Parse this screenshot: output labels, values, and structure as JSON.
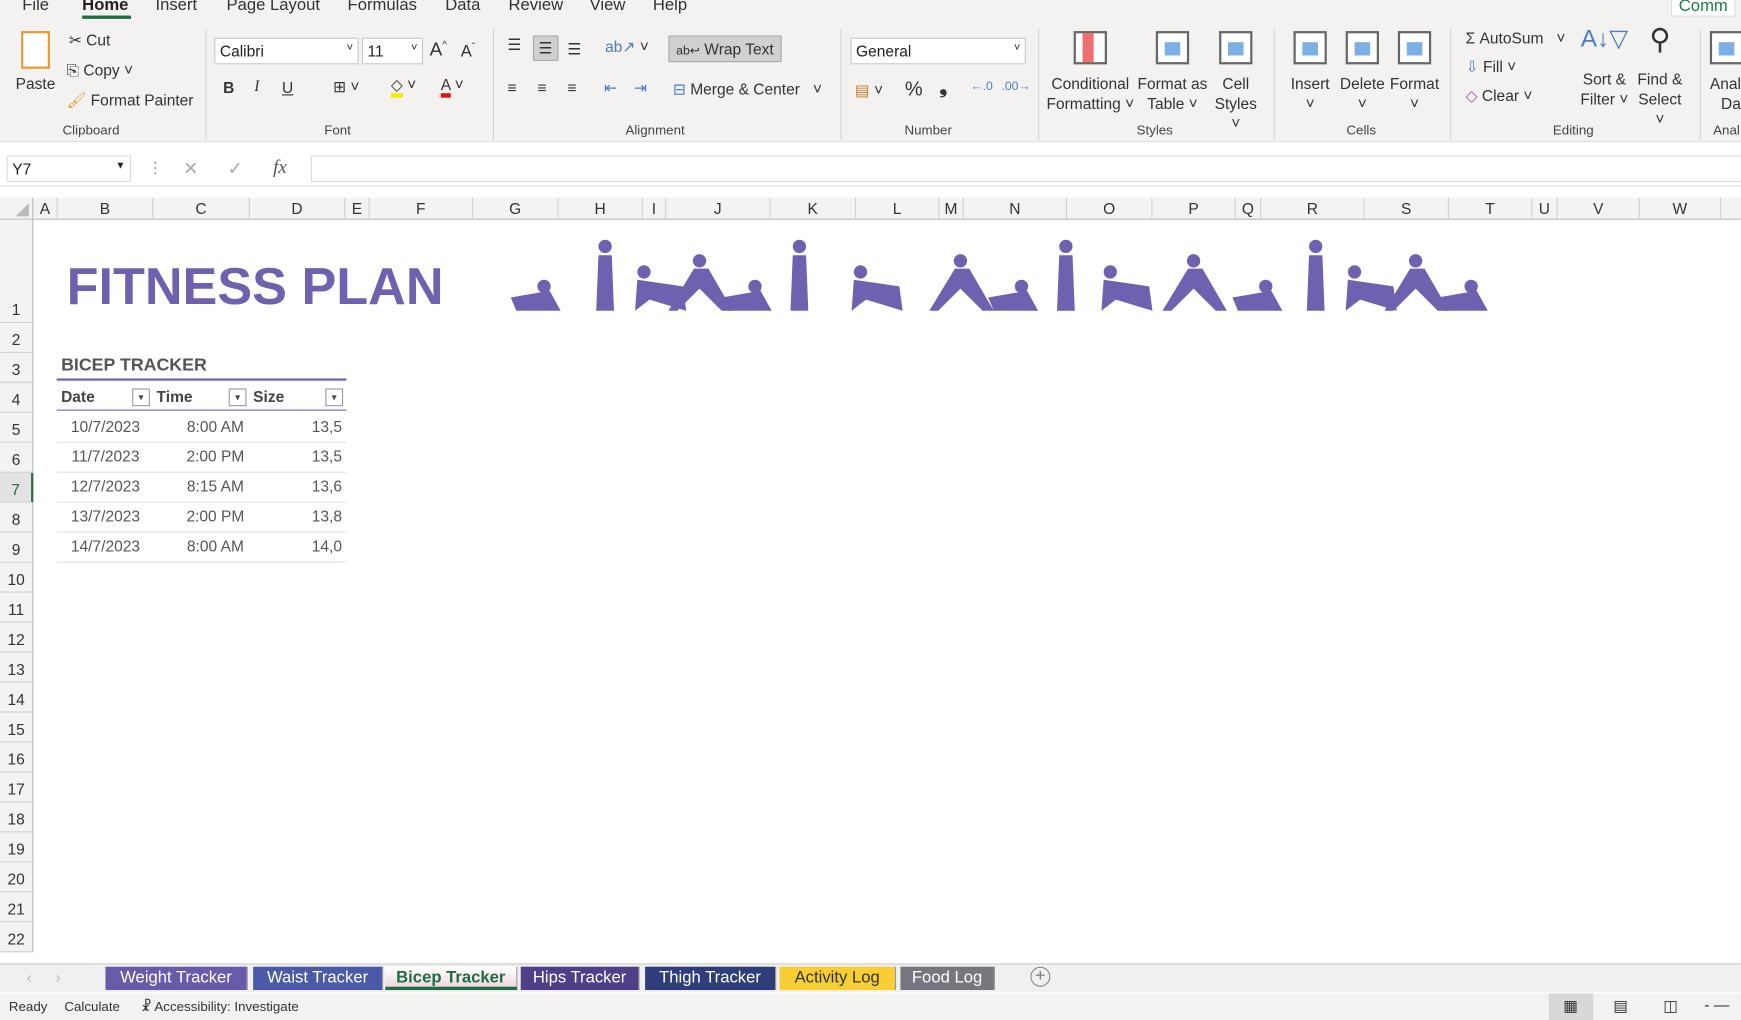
{
  "menu": [
    "File",
    "Home",
    "Insert",
    "Page Layout",
    "Formulas",
    "Data",
    "Review",
    "View",
    "Help"
  ],
  "comments_label": "Comm",
  "clipboard": {
    "paste": "Paste",
    "cut": "Cut",
    "copy": "Copy",
    "format_painter": "Format Painter",
    "group": "Clipboard"
  },
  "font": {
    "name": "Calibri",
    "size": "11",
    "bold": "B",
    "italic": "I",
    "underline": "U",
    "group": "Font"
  },
  "alignment": {
    "wrap_text": "Wrap Text",
    "merge_center": "Merge & Center",
    "group": "Alignment"
  },
  "number": {
    "format": "General",
    "percent": "%",
    "comma": "❟",
    "group": "Number"
  },
  "styles": {
    "conditional": [
      "Conditional",
      "Formatting ˅"
    ],
    "format_table": [
      "Format as",
      "Table ˅"
    ],
    "cell_styles": [
      "Cell",
      "Styles ˅"
    ],
    "group": "Styles"
  },
  "cells": {
    "insert": "Insert",
    "delete": "Delete",
    "format": "Format",
    "group": "Cells"
  },
  "editing": {
    "autosum": "AutoSum",
    "fill": "Fill",
    "clear": "Clear",
    "sort": [
      "Sort &",
      "Filter ˅"
    ],
    "find": [
      "Find &",
      "Select ˅"
    ],
    "group": "Editing"
  },
  "analyze": [
    "Anal",
    "Da"
  ],
  "analyze_group": "Anal",
  "formula_bar": {
    "name_box": "Y7",
    "fx": "fx",
    "value": ""
  },
  "columns": [
    "A",
    "B",
    "C",
    "D",
    "E",
    "F",
    "G",
    "H",
    "I",
    "J",
    "K",
    "L",
    "M",
    "N",
    "O",
    "P",
    "Q",
    "R",
    "S",
    "T",
    "U",
    "V",
    "W"
  ],
  "rows": [
    "1",
    "2",
    "3",
    "4",
    "5",
    "6",
    "7",
    "8",
    "9",
    "10",
    "11",
    "12",
    "13",
    "14",
    "15",
    "16",
    "17",
    "18",
    "19",
    "20",
    "21",
    "22"
  ],
  "sheet": {
    "title": "FITNESS PLAN",
    "tracker_title": "BICEP TRACKER",
    "headers": [
      "Date",
      "Time",
      "Size"
    ],
    "data": [
      [
        "10/7/2023",
        "8:00 AM",
        "13,5"
      ],
      [
        "11/7/2023",
        "2:00 PM",
        "13,5"
      ],
      [
        "12/7/2023",
        "8:15 AM",
        "13,6"
      ],
      [
        "13/7/2023",
        "2:00 PM",
        "13,8"
      ],
      [
        "14/7/2023",
        "8:00 AM",
        "14,0"
      ]
    ]
  },
  "tabs": [
    {
      "label": "Weight Tracker",
      "color": "#6a5aaa"
    },
    {
      "label": "Waist Tracker",
      "color": "#4a5aa8"
    },
    {
      "label": "Bicep Tracker",
      "color": "#f4e4ea"
    },
    {
      "label": "Hips Tracker",
      "color": "#4f3f88"
    },
    {
      "label": "Thigh Tracker",
      "color": "#2f3d7a"
    },
    {
      "label": "Activity Log",
      "color": "#f7cf35"
    },
    {
      "label": "Food Log",
      "color": "#77767e"
    }
  ],
  "status": {
    "ready": "Ready",
    "calculate": "Calculate",
    "accessibility": "Accessibility: Investigate"
  },
  "accent": "#7060b0"
}
